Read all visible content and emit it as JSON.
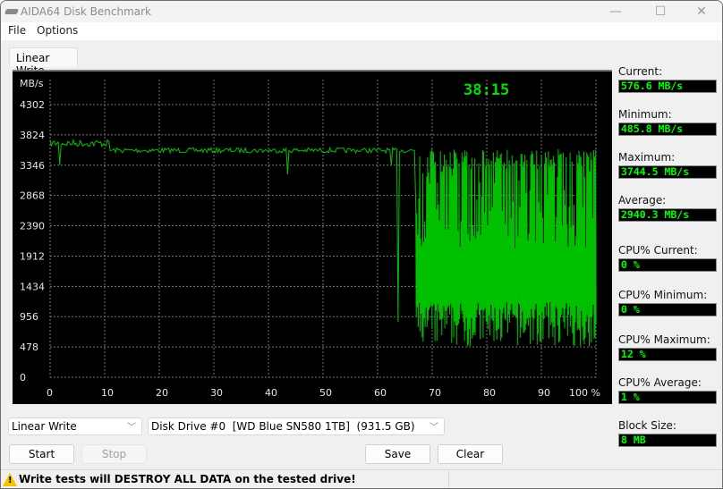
{
  "window": {
    "title": "AIDA64 Disk Benchmark",
    "controls": {
      "minimize": "—",
      "maximize": "☐",
      "close": "✕"
    }
  },
  "menu": [
    {
      "label": "File"
    },
    {
      "label": "Options"
    }
  ],
  "tab": {
    "label": "Linear Write"
  },
  "chart_data": {
    "type": "line",
    "title": "",
    "timer": "38:15",
    "ylabel": "MB/s",
    "xlabel": "%",
    "ylim": [
      0,
      4302
    ],
    "xlim": [
      0,
      100
    ],
    "y_ticks": [
      "0",
      "478",
      "956",
      "1434",
      "1912",
      "2390",
      "2868",
      "3346",
      "3824",
      "4302"
    ],
    "x_ticks": [
      "0",
      "10",
      "20",
      "30",
      "40",
      "50",
      "60",
      "70",
      "80",
      "90",
      "100 %"
    ],
    "grid": true,
    "line_color": "#00c000",
    "segments": [
      {
        "name": "steady-high",
        "x_range": [
          0,
          11
        ],
        "mean": 3720,
        "noise": 70,
        "dips": [
          {
            "x": 1.8,
            "y": 3350
          }
        ]
      },
      {
        "name": "steady",
        "x_range": [
          11,
          67
        ],
        "mean": 3600,
        "noise": 50,
        "dips": [
          {
            "x": 43.5,
            "y": 3200
          },
          {
            "x": 62.5,
            "y": 3350
          },
          {
            "x": 63.8,
            "y": 870
          }
        ]
      },
      {
        "name": "oscillating",
        "x_range": [
          67,
          100
        ],
        "low": 485.8,
        "high": 3600
      }
    ]
  },
  "stats": [
    {
      "label": "Current:",
      "value": "576.6 MB/s"
    },
    {
      "label": "Minimum:",
      "value": "485.8 MB/s"
    },
    {
      "label": "Maximum:",
      "value": "3744.5 MB/s"
    },
    {
      "label": "Average:",
      "value": "2940.3 MB/s"
    },
    {
      "label": "CPU% Current:",
      "value": "0 %"
    },
    {
      "label": "CPU% Minimum:",
      "value": "0 %"
    },
    {
      "label": "CPU% Maximum:",
      "value": "12 %"
    },
    {
      "label": "CPU% Average:",
      "value": "1 %"
    },
    {
      "label": "Block Size:",
      "value": "8 MB"
    }
  ],
  "controls": {
    "test_select": "Linear Write",
    "drive_select": "Disk Drive #0  [WD Blue SN580 1TB]  (931.5 GB)",
    "start": "Start",
    "stop": "Stop",
    "save": "Save",
    "clear": "Clear"
  },
  "status": {
    "warning": "Write tests will DESTROY ALL DATA on the tested drive!"
  }
}
